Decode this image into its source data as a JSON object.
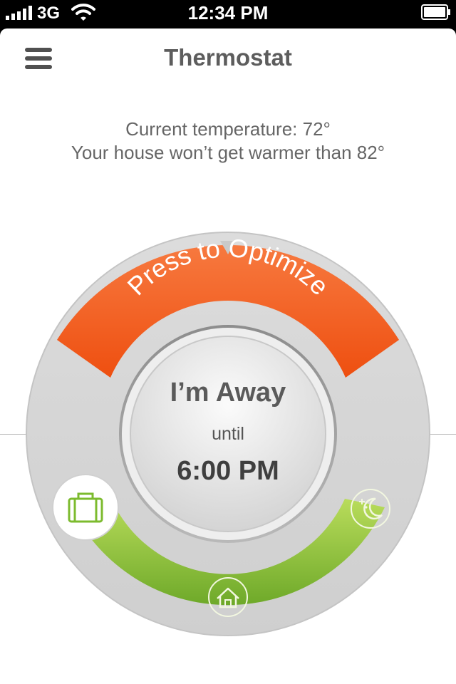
{
  "status_bar": {
    "carrier": "3G",
    "time": "12:34 PM",
    "icons": [
      "signal-icon",
      "wifi-icon",
      "battery-icon"
    ]
  },
  "header": {
    "title": "Thermostat",
    "menu_icon": "hamburger-menu-icon"
  },
  "info": {
    "current_temperature": "Current temperature: 72°",
    "max_temperature": "Your house won’t get warmer than 82°"
  },
  "dial": {
    "optimize_label": "Press to Optimize",
    "mode_label": "I’m Away",
    "until_label": "until",
    "until_time": "6:00 PM",
    "mode_icons": [
      "suitcase-icon",
      "home-icon",
      "moon-icon"
    ]
  },
  "colors": {
    "optimize_orange": "#f15a22",
    "schedule_green": "#8cc63f",
    "text_gray": "#5d5d5d"
  }
}
